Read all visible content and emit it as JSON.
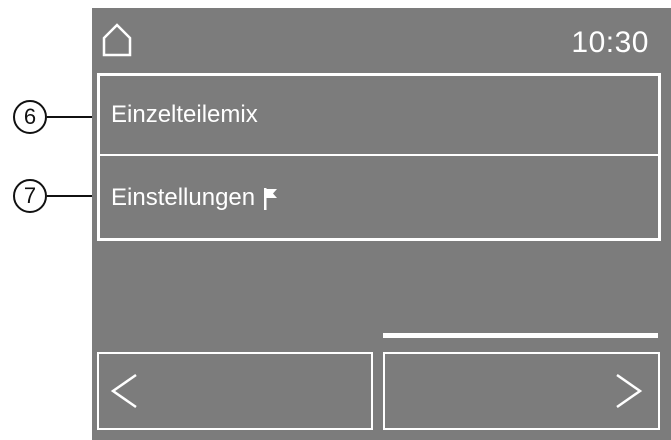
{
  "annotations": {
    "callout_1": "6",
    "callout_2": "7"
  },
  "status_bar": {
    "home_icon": "home-icon",
    "time": "10:30"
  },
  "menu": {
    "items": [
      {
        "label": "Einzelteilemix"
      },
      {
        "label": "Einstellungen",
        "icon": "flag-icon"
      }
    ]
  },
  "navigation": {
    "back_icon": "chevron-left-icon",
    "forward_icon": "chevron-right-icon"
  },
  "colors": {
    "screen_background": "#7c7c7c",
    "foreground": "#ffffff",
    "annotation": "#111111"
  }
}
